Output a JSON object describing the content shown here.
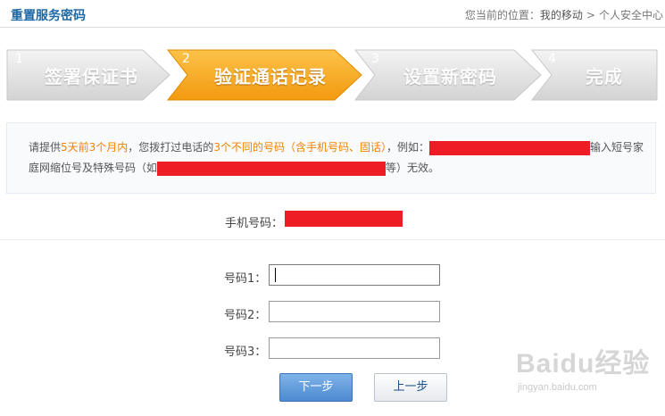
{
  "header": {
    "title": "重置服务密码",
    "breadcrumb_prefix": "您当前的位置：",
    "breadcrumb_link": "我的移动",
    "breadcrumb_sep": ">",
    "breadcrumb_current": "个人安全中心"
  },
  "steps": [
    {
      "num": "1",
      "label": "签署保证书",
      "state": "inactive"
    },
    {
      "num": "2",
      "label": "验证通话记录",
      "state": "active"
    },
    {
      "num": "3",
      "label": "设置新密码",
      "state": "inactive"
    },
    {
      "num": "4",
      "label": "完成",
      "state": "inactive"
    }
  ],
  "notice": {
    "p1": "请提供",
    "hl1": "5天前3个月内",
    "p2": "，您拨打过电话的",
    "hl2": "3个不同的号码（含手机号码、固话）",
    "p3": "，例如：",
    "p4": "输入短号家庭网缩位号及特殊号码（如",
    "p5": "等）无效。"
  },
  "phone": {
    "label": "手机号码："
  },
  "form": {
    "fields": [
      {
        "label": "号码1：",
        "value": ""
      },
      {
        "label": "号码2：",
        "value": ""
      },
      {
        "label": "号码3：",
        "value": ""
      }
    ]
  },
  "buttons": {
    "next": "下一步",
    "prev": "上一步"
  },
  "watermark": {
    "logo": "Baidu经验",
    "url": "jingyan.baidu.com"
  },
  "colors": {
    "accent_blue": "#1e69a5",
    "active_step": "#f7a61c",
    "highlight": "#f08300",
    "redaction": "#ee1c25"
  }
}
